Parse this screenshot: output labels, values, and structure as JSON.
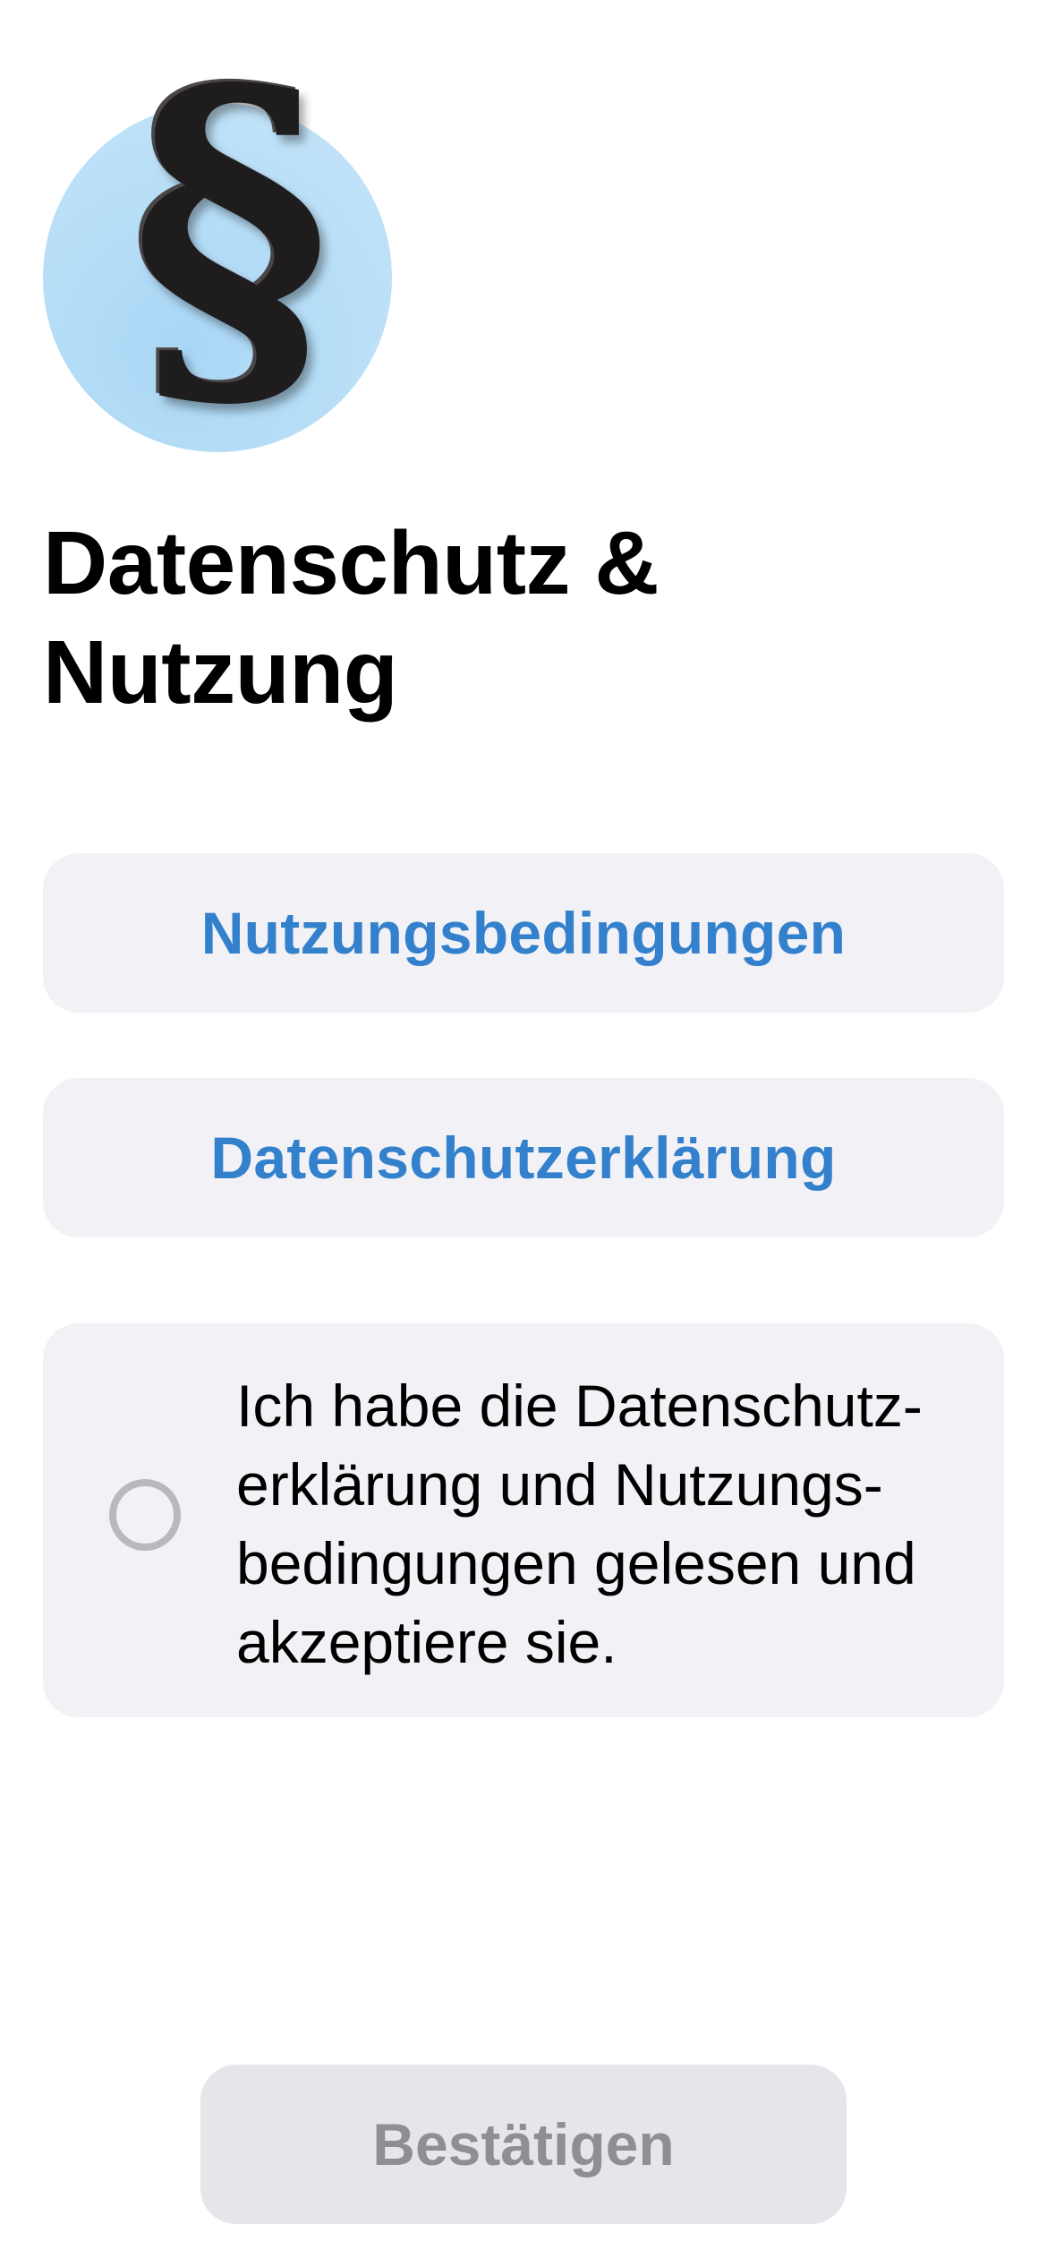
{
  "header": {
    "icon_name": "section-sign-icon",
    "icon_glyph": "§",
    "title": "Datenschutz &\nNutzung"
  },
  "links": {
    "terms_label": "Nutzungsbedingungen",
    "privacy_label": "Datenschutzerklärung",
    "link_color": "#3380cc"
  },
  "consent": {
    "checked": false,
    "text": "Ich habe die Datenschutz-\nerklärung und Nutzungs-\nbedingungen gelesen und\nakzeptiere sie."
  },
  "footer": {
    "confirm_label": "Bestätigen",
    "confirm_enabled": false
  }
}
